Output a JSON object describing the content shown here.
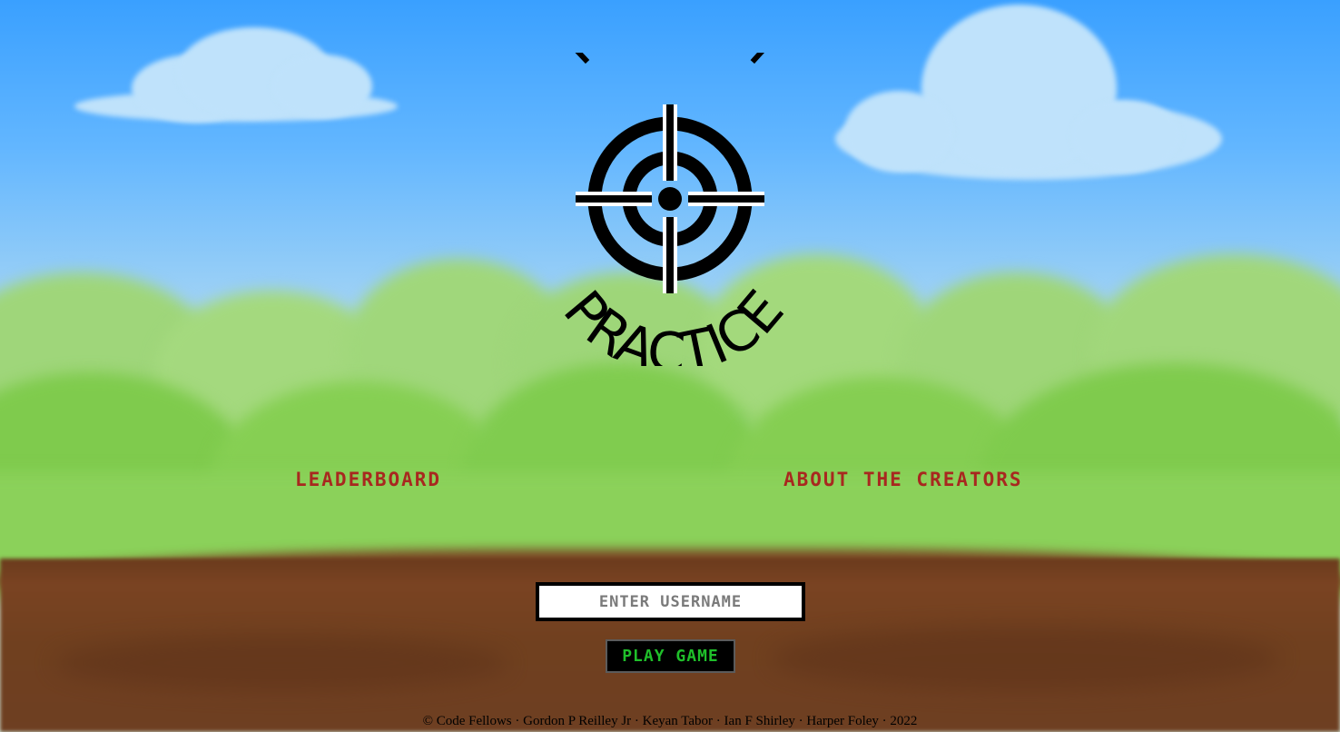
{
  "logo": {
    "top_text": "TARGET",
    "bottom_text": "PRACTICE",
    "icon": "crosshair-target-icon"
  },
  "nav": {
    "leaderboard_label": "LEADERBOARD",
    "about_label": "ABOUT THE CREATORS"
  },
  "form": {
    "username_placeholder": "ENTER USERNAME",
    "username_value": "",
    "play_label": "PLAY GAME"
  },
  "footer": {
    "text": "© Code Fellows · Gordon P Reilley Jr · Keyan Tabor · Ian F Shirley · Harper Foley · 2022"
  },
  "colors": {
    "nav_link": "#a8281f",
    "play_text": "#1fbf2a",
    "play_bg": "#000000"
  }
}
